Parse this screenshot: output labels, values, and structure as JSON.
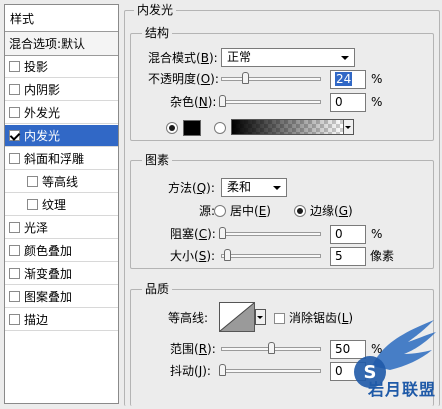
{
  "sidebar": {
    "title": "样式",
    "blend_options": "混合选项:默认",
    "items": [
      {
        "label": "投影",
        "checked": false,
        "sub": false,
        "selected": false
      },
      {
        "label": "内阴影",
        "checked": false,
        "sub": false,
        "selected": false
      },
      {
        "label": "外发光",
        "checked": false,
        "sub": false,
        "selected": false
      },
      {
        "label": "内发光",
        "checked": true,
        "sub": false,
        "selected": true
      },
      {
        "label": "斜面和浮雕",
        "checked": false,
        "sub": false,
        "selected": false
      },
      {
        "label": "等高线",
        "checked": false,
        "sub": true,
        "selected": false
      },
      {
        "label": "纹理",
        "checked": false,
        "sub": true,
        "selected": false
      },
      {
        "label": "光泽",
        "checked": false,
        "sub": false,
        "selected": false
      },
      {
        "label": "颜色叠加",
        "checked": false,
        "sub": false,
        "selected": false
      },
      {
        "label": "渐变叠加",
        "checked": false,
        "sub": false,
        "selected": false
      },
      {
        "label": "图案叠加",
        "checked": false,
        "sub": false,
        "selected": false
      },
      {
        "label": "描边",
        "checked": false,
        "sub": false,
        "selected": false
      }
    ]
  },
  "panel": {
    "title": "内发光",
    "structure": {
      "title": "结构",
      "blend_mode_label": "混合模式",
      "blend_mode_key": "B",
      "blend_mode_value": "正常",
      "opacity_label": "不透明度",
      "opacity_key": "O",
      "opacity_value": "24",
      "opacity_unit": "%",
      "noise_label": "杂色",
      "noise_key": "N",
      "noise_value": "0",
      "noise_unit": "%",
      "glow_color": "#000000"
    },
    "elements": {
      "title": "图素",
      "method_label": "方法",
      "method_key": "Q",
      "method_value": "柔和",
      "source_label": "源",
      "source_center": "居中",
      "source_center_key": "E",
      "source_edge": "边缘",
      "source_edge_key": "G",
      "choke_label": "阻塞",
      "choke_key": "C",
      "choke_value": "0",
      "choke_unit": "%",
      "size_label": "大小",
      "size_key": "S",
      "size_value": "5",
      "size_unit": "像素"
    },
    "quality": {
      "title": "品质",
      "contour_label": "等高线",
      "antialias_label": "消除锯齿",
      "antialias_key": "L",
      "range_label": "范围",
      "range_key": "R",
      "range_value": "50",
      "range_unit": "%",
      "jitter_label": "抖动",
      "jitter_key": "J",
      "jitter_value": "0"
    }
  },
  "watermark": {
    "text": "岩月联盟"
  },
  "colors": {
    "selection": "#3168c6",
    "watermark": "#1f5aa8"
  }
}
